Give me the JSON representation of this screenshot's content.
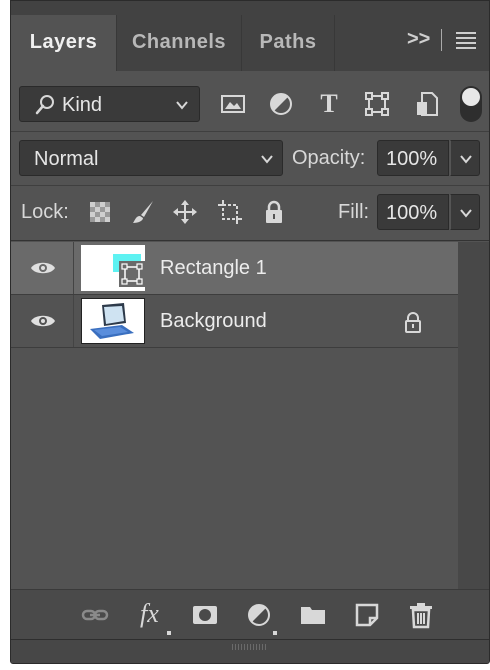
{
  "tabs": [
    {
      "label": "Layers",
      "active": true
    },
    {
      "label": "Channels",
      "active": false
    },
    {
      "label": "Paths",
      "active": false
    }
  ],
  "panel_controls": {
    "collapse_icon": "double-chevron-right-icon",
    "collapse_glyph": ">>",
    "menu_icon": "hamburger-menu-icon"
  },
  "filter": {
    "kind_label": "Kind",
    "icons": [
      "pixel-layer-filter-icon",
      "adjustment-layer-filter-icon",
      "type-layer-filter-icon",
      "shape-layer-filter-icon",
      "smart-object-filter-icon"
    ],
    "type_glyph": "T",
    "toggle_on": true
  },
  "blend": {
    "mode": "Normal",
    "opacity_label": "Opacity:",
    "opacity_value": "100%"
  },
  "lock": {
    "label": "Lock:",
    "icons": [
      "lock-transparent-pixels-icon",
      "lock-image-pixels-icon",
      "lock-position-icon",
      "lock-artboard-icon",
      "lock-all-icon"
    ],
    "fill_label": "Fill:",
    "fill_value": "100%"
  },
  "layers": [
    {
      "name": "Rectangle 1",
      "visible": true,
      "selected": true,
      "kind": "shape",
      "thumb_accent": "#5ef2f2",
      "locked": false
    },
    {
      "name": "Background",
      "visible": true,
      "selected": false,
      "kind": "pixel",
      "locked": true
    }
  ],
  "bottom_icons": [
    "link-layers-icon",
    "fx-icon",
    "layer-mask-icon",
    "adjustment-layer-icon",
    "group-folder-icon",
    "new-layer-icon",
    "trash-icon"
  ],
  "fx_label": "fx",
  "colors": {
    "panel_bg": "#535353",
    "tab_bar_bg": "#424242",
    "selected_row": "#6a6a6a",
    "field_bg": "#3a3a3a"
  }
}
